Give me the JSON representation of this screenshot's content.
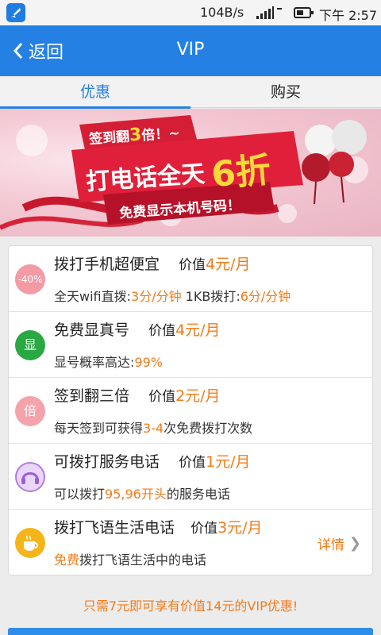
{
  "status_bar": {
    "speed": "104B/s",
    "time": "下午 2:57"
  },
  "header": {
    "back_label": "返回",
    "title": "VIP"
  },
  "tabs": [
    {
      "label": "优惠",
      "active": true
    },
    {
      "label": "购买",
      "active": false
    }
  ],
  "banner": {
    "line1_prefix": "签到翻",
    "line1_emph": "3",
    "line1_suffix": "倍！~",
    "line2": "打电话全天",
    "line2_big": "6折",
    "line3": "免费显示本机号码！"
  },
  "benefits": [
    {
      "icon": "discount-40-icon",
      "icon_text": "-40%",
      "icon_color": "#f39aa4",
      "title": "拨打手机超便宜",
      "value_prefix": "价值",
      "value_amount": "4元/月",
      "desc": [
        {
          "t": "全天wifi直拨:",
          "hl": false
        },
        {
          "t": "3分/分钟",
          "hl": true
        },
        {
          "t": " 1KB拨打:",
          "hl": false
        },
        {
          "t": "6分/分钟",
          "hl": true
        }
      ]
    },
    {
      "icon": "display-number-icon",
      "icon_text": "显",
      "icon_color": "#2aa842",
      "title": "免费显真号",
      "value_prefix": "价值",
      "value_amount": "4元/月",
      "desc": [
        {
          "t": "显号概率高达:",
          "hl": false
        },
        {
          "t": "99%",
          "hl": true
        }
      ]
    },
    {
      "icon": "double-checkin-icon",
      "icon_text": "倍",
      "icon_color": "#f5a3ab",
      "title": "签到翻三倍",
      "value_prefix": "价值",
      "value_amount": "2元/月",
      "desc": [
        {
          "t": "每天签到可获得",
          "hl": false
        },
        {
          "t": "3-4",
          "hl": true
        },
        {
          "t": "次免费拨打次数",
          "hl": false
        }
      ]
    },
    {
      "icon": "headset-service-icon",
      "icon_text": "",
      "icon_color": "#b37be0",
      "title": "可拨打服务电话",
      "value_prefix": "价值",
      "value_amount": "1元/月",
      "desc": [
        {
          "t": "可以拨打",
          "hl": false
        },
        {
          "t": "95,96开头",
          "hl": true
        },
        {
          "t": "的服务电话",
          "hl": false
        }
      ]
    },
    {
      "icon": "coffee-cup-icon",
      "icon_text": "",
      "icon_color": "#f5b418",
      "title": "拨打飞语生活电话",
      "value_prefix": "价值",
      "value_amount": "3元/月",
      "desc": [
        {
          "t": "免费",
          "hl": true
        },
        {
          "t": "拨打飞语生活中的电话",
          "hl": false
        }
      ],
      "detail_label": "详情"
    }
  ],
  "footer_note": "只需7元即可享有价值14元的VIP优惠!"
}
